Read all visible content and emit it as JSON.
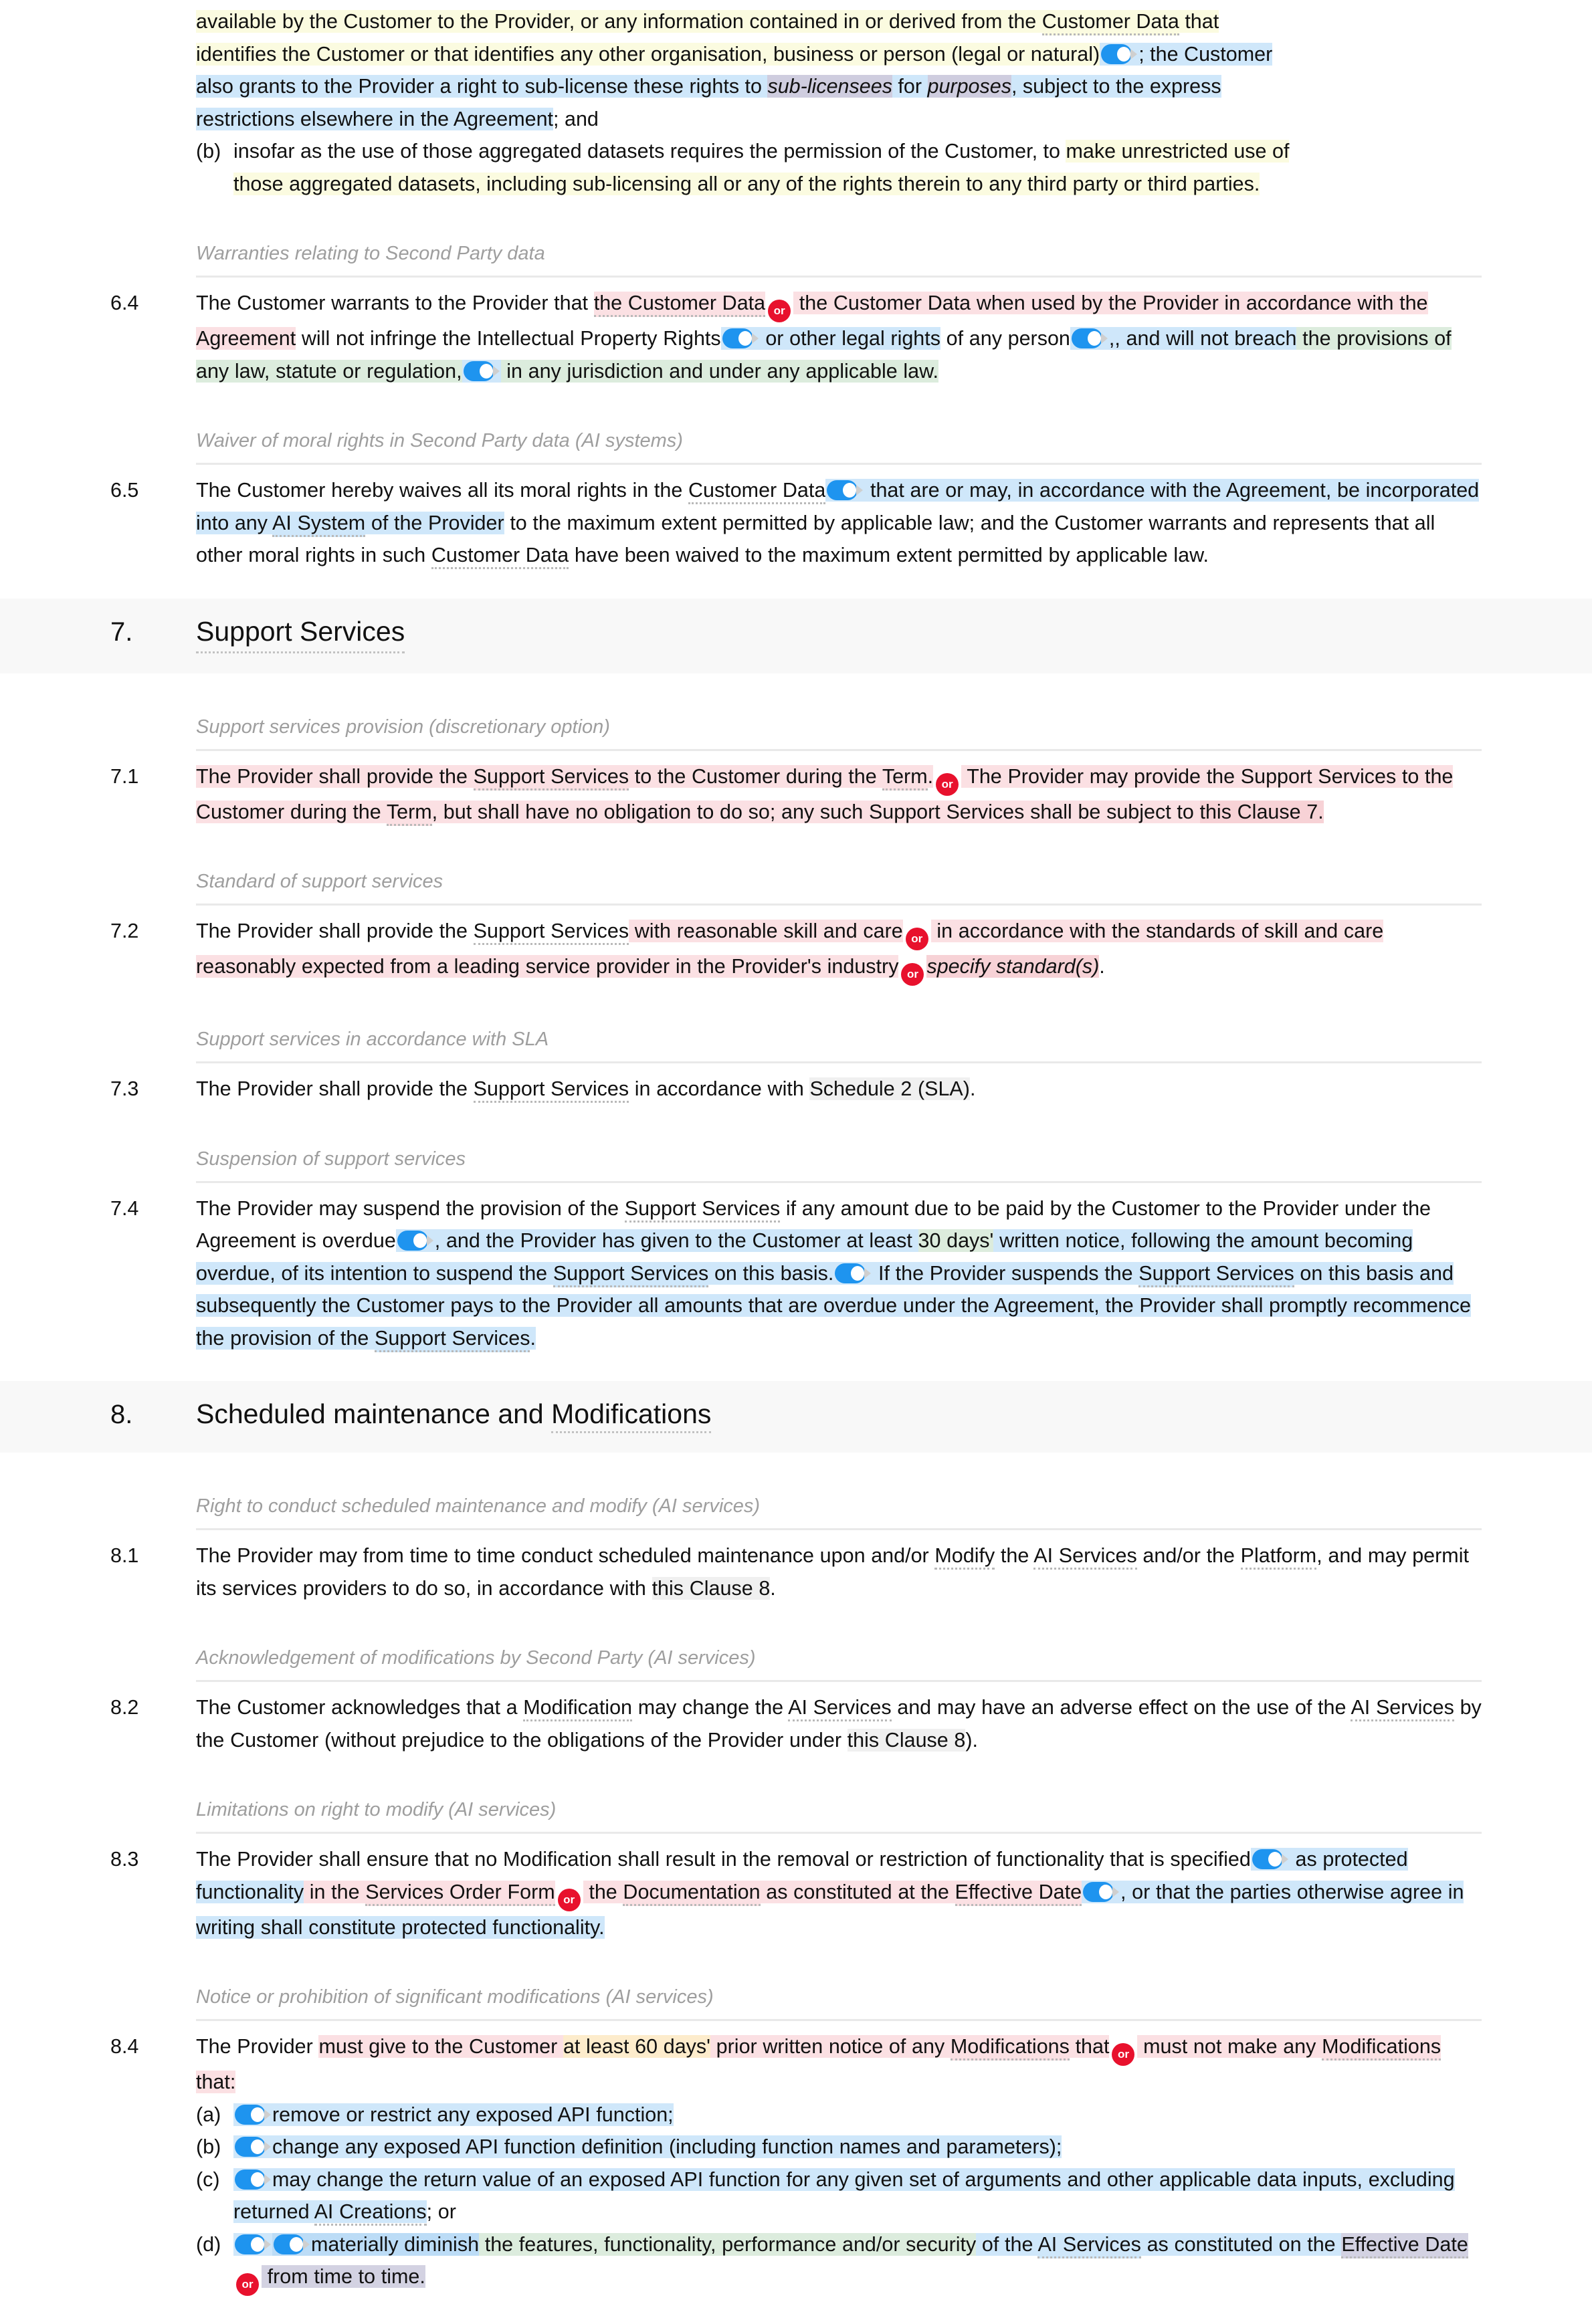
{
  "colors": {
    "toggle_on": "#1e94ef",
    "or_badge": "#e8112d",
    "highlight_yellow": "#fbfbe0",
    "highlight_blue": "#cfe7fa",
    "highlight_pink": "#fbe0e3",
    "highlight_pink_dark": "#f7d2d6",
    "highlight_green": "#dcecdd",
    "highlight_purple": "#cfcddf",
    "highlight_lavender": "#d3d2e2",
    "highlight_orange": "#fdeccc",
    "highlight_grey": "#f0f0f0",
    "label_grey": "#9e9e9e",
    "section_band": "#f8f8f8"
  },
  "icons": {
    "toggle": "toggle-switch-on-icon",
    "or": "or-alternative-badge"
  },
  "top_paragraph": {
    "line1": "available by the Customer to the Provider, or any information contained in or derived from the ",
    "term1": "Customer Data",
    "line1b": " that",
    "line2a": "identifies the Customer or that identifies any other organisation, business or person (legal or natural)",
    "line2b": "; the Customer",
    "line3a": "also grants to the Provider a right to sub-license these rights to ",
    "line3_sublicensees": "sub-licensees",
    "line3b": " for ",
    "line3_purposes": "purposes",
    "line3c": ", subject to the express",
    "line4": "restrictions elsewhere in the Agreement",
    "line4b": "; and"
  },
  "item_b": {
    "letter": "(b)",
    "text_a": "insofar as the use of those aggregated datasets requires the permission of the Customer, to ",
    "text_hl": "make unrestricted use of",
    "text_b": "those aggregated datasets, including sub-licensing all or any of the rights therein to any third party or third parties."
  },
  "clauses": {
    "c64": {
      "number": "6.4",
      "label": "Warranties relating to Second Party data",
      "t1": "The Customer warrants to the Provider that ",
      "t2": "the Customer Data",
      "t3": " the Customer Data when used by the Provider in accordance with the Agreement",
      "t4": " will not infringe the Intellectual Property Rights",
      "t5": " or other legal rights",
      "t6": " of any person",
      "t7": ", and will not breach",
      "t8": " the provisions of any law, statute or regulation,",
      "t9": " in any jurisdiction and under any applicable law."
    },
    "c65": {
      "number": "6.5",
      "label": "Waiver of moral rights in Second Party data (AI systems)",
      "t1": "The Customer hereby waives all its moral rights in the ",
      "term1": "Customer Data",
      "t2": " that are or may, in accordance with the Agreement, be incorporated into any ",
      "term2": "AI System",
      "t3": " of the Provider",
      "t4": " to the maximum extent permitted by applicable law; and the Customer warrants and represents that all other moral rights in such ",
      "term3": "Customer Data",
      "t5": " have been waived to the maximum extent permitted by applicable law."
    },
    "c71": {
      "number": "7.1",
      "label": "Support services provision (discretionary option)",
      "t1": "The Provider shall provide the ",
      "term1": "Support Services",
      "t2": " to the Customer during the ",
      "term2": "Term",
      "t3": ".",
      "t4": " The Provider may provide the Support Services to the Customer during the ",
      "term3": "Term",
      "t5": ", but shall have no obligation to do so; any such Support Services shall be subject to ",
      "xref": "this Clause 7",
      "t6": "."
    },
    "c72": {
      "number": "7.2",
      "label": "Standard of support services",
      "t1": "The Provider shall provide the ",
      "term1": "Support Services",
      "t2": " with reasonable skill and care",
      "t3": " in accordance with the standards of skill and care reasonably expected from a leading service provider in the Provider's industry",
      "t4": "specify standard(s)",
      "t5": "."
    },
    "c73": {
      "number": "7.3",
      "label": "Support services in accordance with SLA",
      "t1": "The Provider shall provide the ",
      "term1": "Support Services",
      "t2": " in accordance with ",
      "xref": "Schedule 2 (SLA)",
      "t3": "."
    },
    "c74": {
      "number": "7.4",
      "label": "Suspension of support services",
      "t1": "The Provider may suspend the provision of the ",
      "term1": "Support Services",
      "t2": " if any amount due to be paid by the Customer to the Provider under the Agreement is overdue",
      "t3": ", and the Provider has given to the Customer at least ",
      "t4": "30 days'",
      "t5": " written notice, following the amount becoming overdue, of its intention to suspend the ",
      "term2": "Support Services",
      "t6": " on this basis.",
      "t7": " If the Provider suspends the ",
      "term3": "Support Services",
      "t8": " on this basis and subsequently the Customer pays to the Provider all amounts that are overdue under the Agreement, the Provider shall promptly recommence the provision of the ",
      "term4": "Support Services",
      "t9": "."
    },
    "c81": {
      "number": "8.1",
      "label": "Right to conduct scheduled maintenance and modify (AI services)",
      "t1": "The Provider may from time to time conduct scheduled maintenance upon and/or ",
      "term1": "Modify",
      "t2": " the ",
      "term2": "AI Services",
      "t3": " and/or the ",
      "term3": "Platform",
      "t4": ", and may permit its services providers to do so, in accordance with ",
      "xref": "this Clause 8",
      "t5": "."
    },
    "c82": {
      "number": "8.2",
      "label": "Acknowledgement of modifications by Second Party (AI services)",
      "t1": "The Customer acknowledges that a ",
      "term1": "Modification",
      "t2": " may change the ",
      "term2": "AI Services",
      "t3": " and may have an adverse effect on the use of the ",
      "term3": "AI Services",
      "t4": " by the Customer (without prejudice to the obligations of the Provider under ",
      "xref": "this Clause 8",
      "t5": ")."
    },
    "c83": {
      "number": "8.3",
      "label": "Limitations on right to modify (AI services)",
      "t1": "The Provider shall ensure that no Modification shall result in the removal or restriction of functionality that is specified",
      "t2": " as protected functionality",
      "t3": " in the ",
      "term1": "Services Order Form",
      "t4": " the ",
      "term2": "Documentation",
      "t5": " as constituted at the ",
      "term3": "Effective Date",
      "t6": ", or that the parties otherwise agree in writing shall constitute protected functionality."
    },
    "c84": {
      "number": "8.4",
      "label": "Notice or prohibition of significant modifications (AI services)",
      "t1": "The Provider ",
      "t2": "must give to the Customer ",
      "t3": "at least 60 days'",
      "t4": " prior written notice of any ",
      "term1": "Modifications",
      "t5": " that",
      "t6": " must not make any ",
      "term2": "Modifications",
      "t7": " that:",
      "items": [
        {
          "letter": "(a)",
          "toggles": 1,
          "text": "remove or restrict any exposed API function;"
        },
        {
          "letter": "(b)",
          "toggles": 1,
          "text": "change any exposed API function definition (including function names and parameters);"
        },
        {
          "letter": "(c)",
          "toggles": 1,
          "text_a": "may change the return value of an exposed API function for any given set of arguments and other applicable data inputs, excluding returned ",
          "term": "AI Creations",
          "text_b": "; or"
        },
        {
          "letter": "(d)",
          "toggles": 2,
          "text_a": "materially diminish",
          "text_b": " the features, functionality, performance and/or security",
          "text_c": " of the ",
          "term": "AI Services",
          "text_d": " as constituted on the ",
          "term2": "Effective Date",
          "text_e": " from time to time."
        }
      ]
    }
  },
  "sections": [
    {
      "number": "7.",
      "title": "Support Services",
      "underline": "Support Services"
    },
    {
      "number": "8.",
      "title": "Scheduled maintenance and Modifications",
      "underline": "Modifications"
    }
  ]
}
